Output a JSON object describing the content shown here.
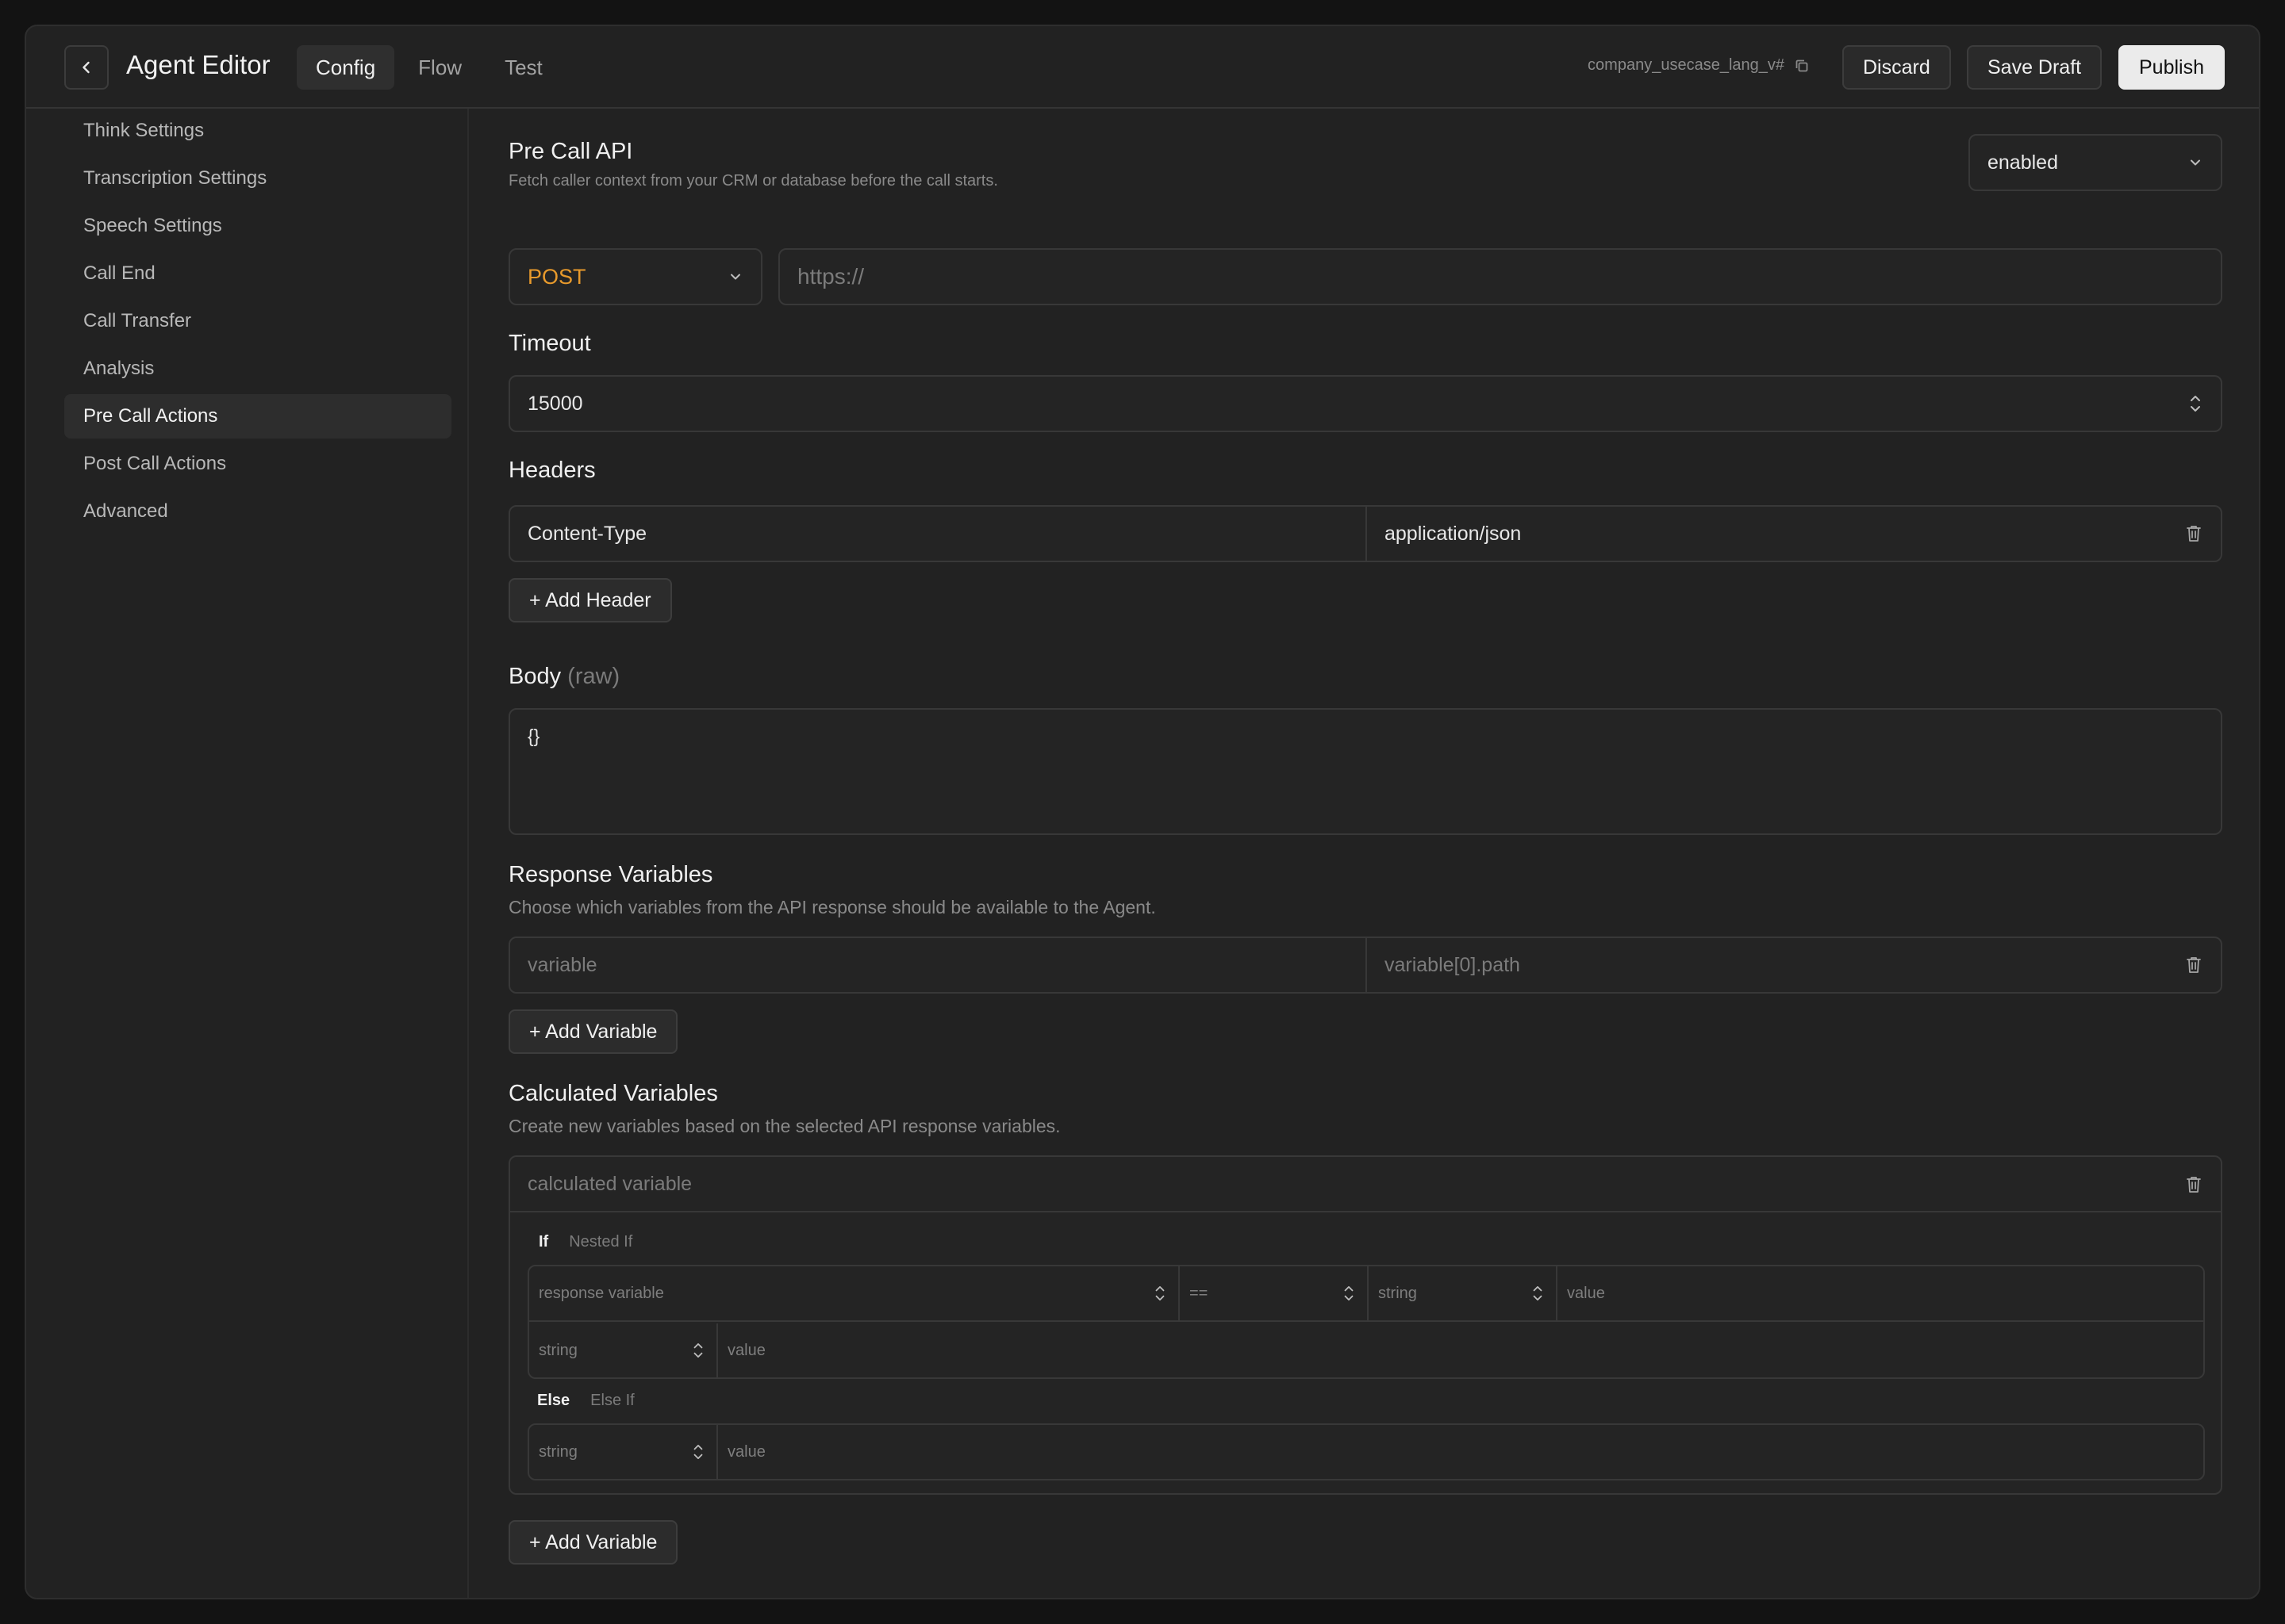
{
  "header": {
    "title": "Agent Editor",
    "tabs": [
      {
        "label": "Config",
        "active": true
      },
      {
        "label": "Flow",
        "active": false
      },
      {
        "label": "Test",
        "active": false
      }
    ],
    "slug": "company_usecase_lang_v#",
    "discard_label": "Discard",
    "save_draft_label": "Save Draft",
    "publish_label": "Publish"
  },
  "sidebar": {
    "items": [
      {
        "label": "Think Settings"
      },
      {
        "label": "Transcription Settings"
      },
      {
        "label": "Speech Settings"
      },
      {
        "label": "Call End"
      },
      {
        "label": "Call Transfer"
      },
      {
        "label": "Analysis"
      },
      {
        "label": "Pre Call Actions",
        "active": true
      },
      {
        "label": "Post Call Actions"
      },
      {
        "label": "Advanced"
      }
    ]
  },
  "pre_call_api": {
    "title": "Pre Call API",
    "description": "Fetch caller context from your CRM or database before the call starts.",
    "status": "enabled",
    "method": "POST",
    "method_color": "#e89a2c",
    "url_placeholder": "https://"
  },
  "timeout": {
    "title": "Timeout",
    "value": "15000"
  },
  "headers": {
    "title": "Headers",
    "rows": [
      {
        "key": "Content-Type",
        "value": "application/json"
      }
    ],
    "add_label": "+ Add Header"
  },
  "body": {
    "title": "Body",
    "title_suffix": "(raw)",
    "value": "{}"
  },
  "response_variables": {
    "title": "Response Variables",
    "description": "Choose which variables from the API response should be available to the Agent.",
    "rows": [
      {
        "name_placeholder": "variable",
        "path_placeholder": "variable[0].path"
      }
    ],
    "add_label": "+ Add Variable"
  },
  "calculated_variables": {
    "title": "Calculated Variables",
    "description": "Create new variables based on the selected API response variables.",
    "name_placeholder": "calculated variable",
    "if_tab": "If",
    "nested_if_tab": "Nested If",
    "condition": {
      "response_variable": "response variable",
      "operator": "==",
      "type": "string",
      "value": "value"
    },
    "then": {
      "type": "string",
      "value": "value"
    },
    "else_tab": "Else",
    "else_if_tab": "Else If",
    "else": {
      "type": "string",
      "value": "value"
    },
    "add_label": "+ Add Variable"
  }
}
